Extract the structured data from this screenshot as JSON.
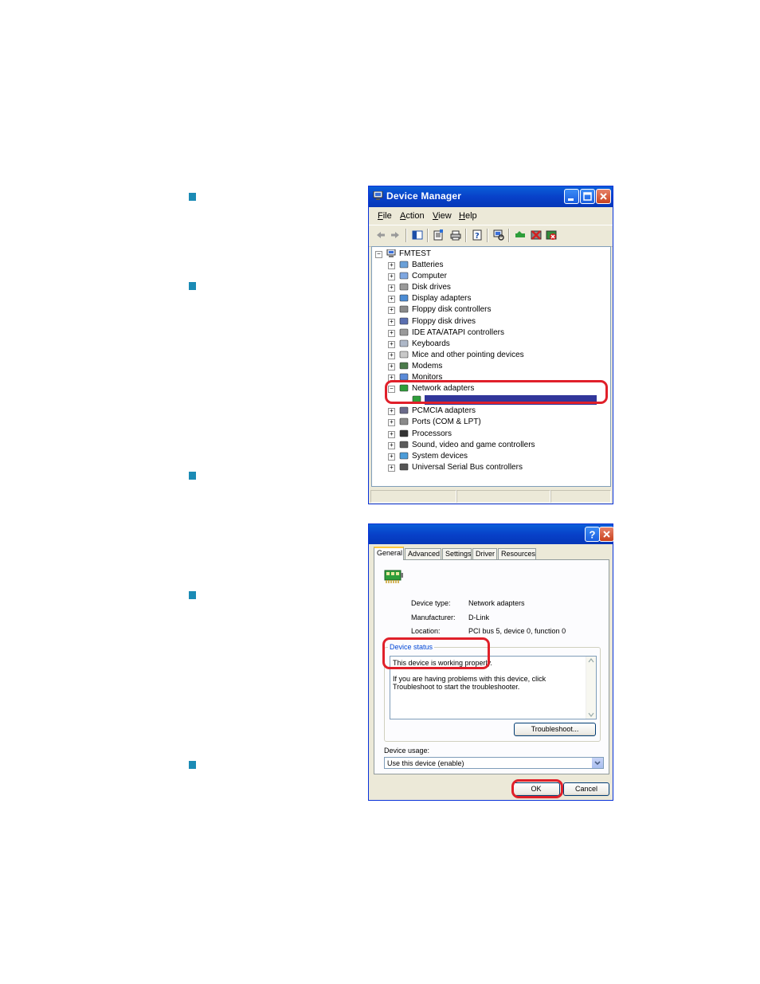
{
  "colors": {
    "accent": "#1b8bb5",
    "title_bar": "#0a5fd8",
    "highlight": "#e0202a",
    "selection": "#31369a"
  },
  "device_manager": {
    "title": "Device Manager",
    "menu": [
      "File",
      "Action",
      "View",
      "Help"
    ],
    "toolbar_icons": [
      "back-icon",
      "forward-icon",
      "show-hide-tree-icon",
      "properties-icon",
      "print-icon",
      "help-icon",
      "scan-hardware-icon",
      "update-driver-icon",
      "disable-device-icon",
      "uninstall-device-icon"
    ],
    "root": "FMTEST",
    "tree": [
      {
        "label": "Batteries",
        "icon": "battery-icon",
        "expanded": false
      },
      {
        "label": "Computer",
        "icon": "computer-icon",
        "expanded": false
      },
      {
        "label": "Disk drives",
        "icon": "disk-drive-icon",
        "expanded": false
      },
      {
        "label": "Display adapters",
        "icon": "display-adapter-icon",
        "expanded": false
      },
      {
        "label": "Floppy disk controllers",
        "icon": "floppy-controller-icon",
        "expanded": false
      },
      {
        "label": "Floppy disk drives",
        "icon": "floppy-drive-icon",
        "expanded": false
      },
      {
        "label": "IDE ATA/ATAPI controllers",
        "icon": "ide-controller-icon",
        "expanded": false
      },
      {
        "label": "Keyboards",
        "icon": "keyboard-icon",
        "expanded": false
      },
      {
        "label": "Mice and other pointing devices",
        "icon": "mouse-icon",
        "expanded": false
      },
      {
        "label": "Modems",
        "icon": "modem-icon",
        "expanded": false
      },
      {
        "label": "Monitors",
        "icon": "monitor-icon",
        "expanded": false
      },
      {
        "label": "Network adapters",
        "icon": "network-adapter-icon",
        "expanded": true
      },
      {
        "label": "",
        "icon": "network-card-icon",
        "child": true,
        "selected": true
      },
      {
        "label": "PCMCIA adapters",
        "icon": "pcmcia-icon",
        "expanded": false
      },
      {
        "label": "Ports (COM & LPT)",
        "icon": "port-icon",
        "expanded": false
      },
      {
        "label": "Processors",
        "icon": "processor-icon",
        "expanded": false
      },
      {
        "label": "Sound, video and game controllers",
        "icon": "sound-icon",
        "expanded": false
      },
      {
        "label": "System devices",
        "icon": "system-device-icon",
        "expanded": false
      },
      {
        "label": "Universal Serial Bus controllers",
        "icon": "usb-icon",
        "expanded": false
      }
    ]
  },
  "properties": {
    "tabs": [
      "General",
      "Advanced",
      "Settings",
      "Driver",
      "Resources"
    ],
    "device_type_label": "Device type:",
    "device_type_value": "Network adapters",
    "manufacturer_label": "Manufacturer:",
    "manufacturer_value": "D-Link",
    "location_label": "Location:",
    "location_value": "PCI bus 5, device 0, function 0",
    "device_status_title": "Device status",
    "status_line1": "This device is working properly.",
    "status_line2": "If you are having problems with this device, click Troubleshoot to start the troubleshooter.",
    "troubleshoot_button": "Troubleshoot...",
    "device_usage_label": "Device usage:",
    "device_usage_value": "Use this device (enable)",
    "ok_button": "OK",
    "cancel_button": "Cancel"
  }
}
